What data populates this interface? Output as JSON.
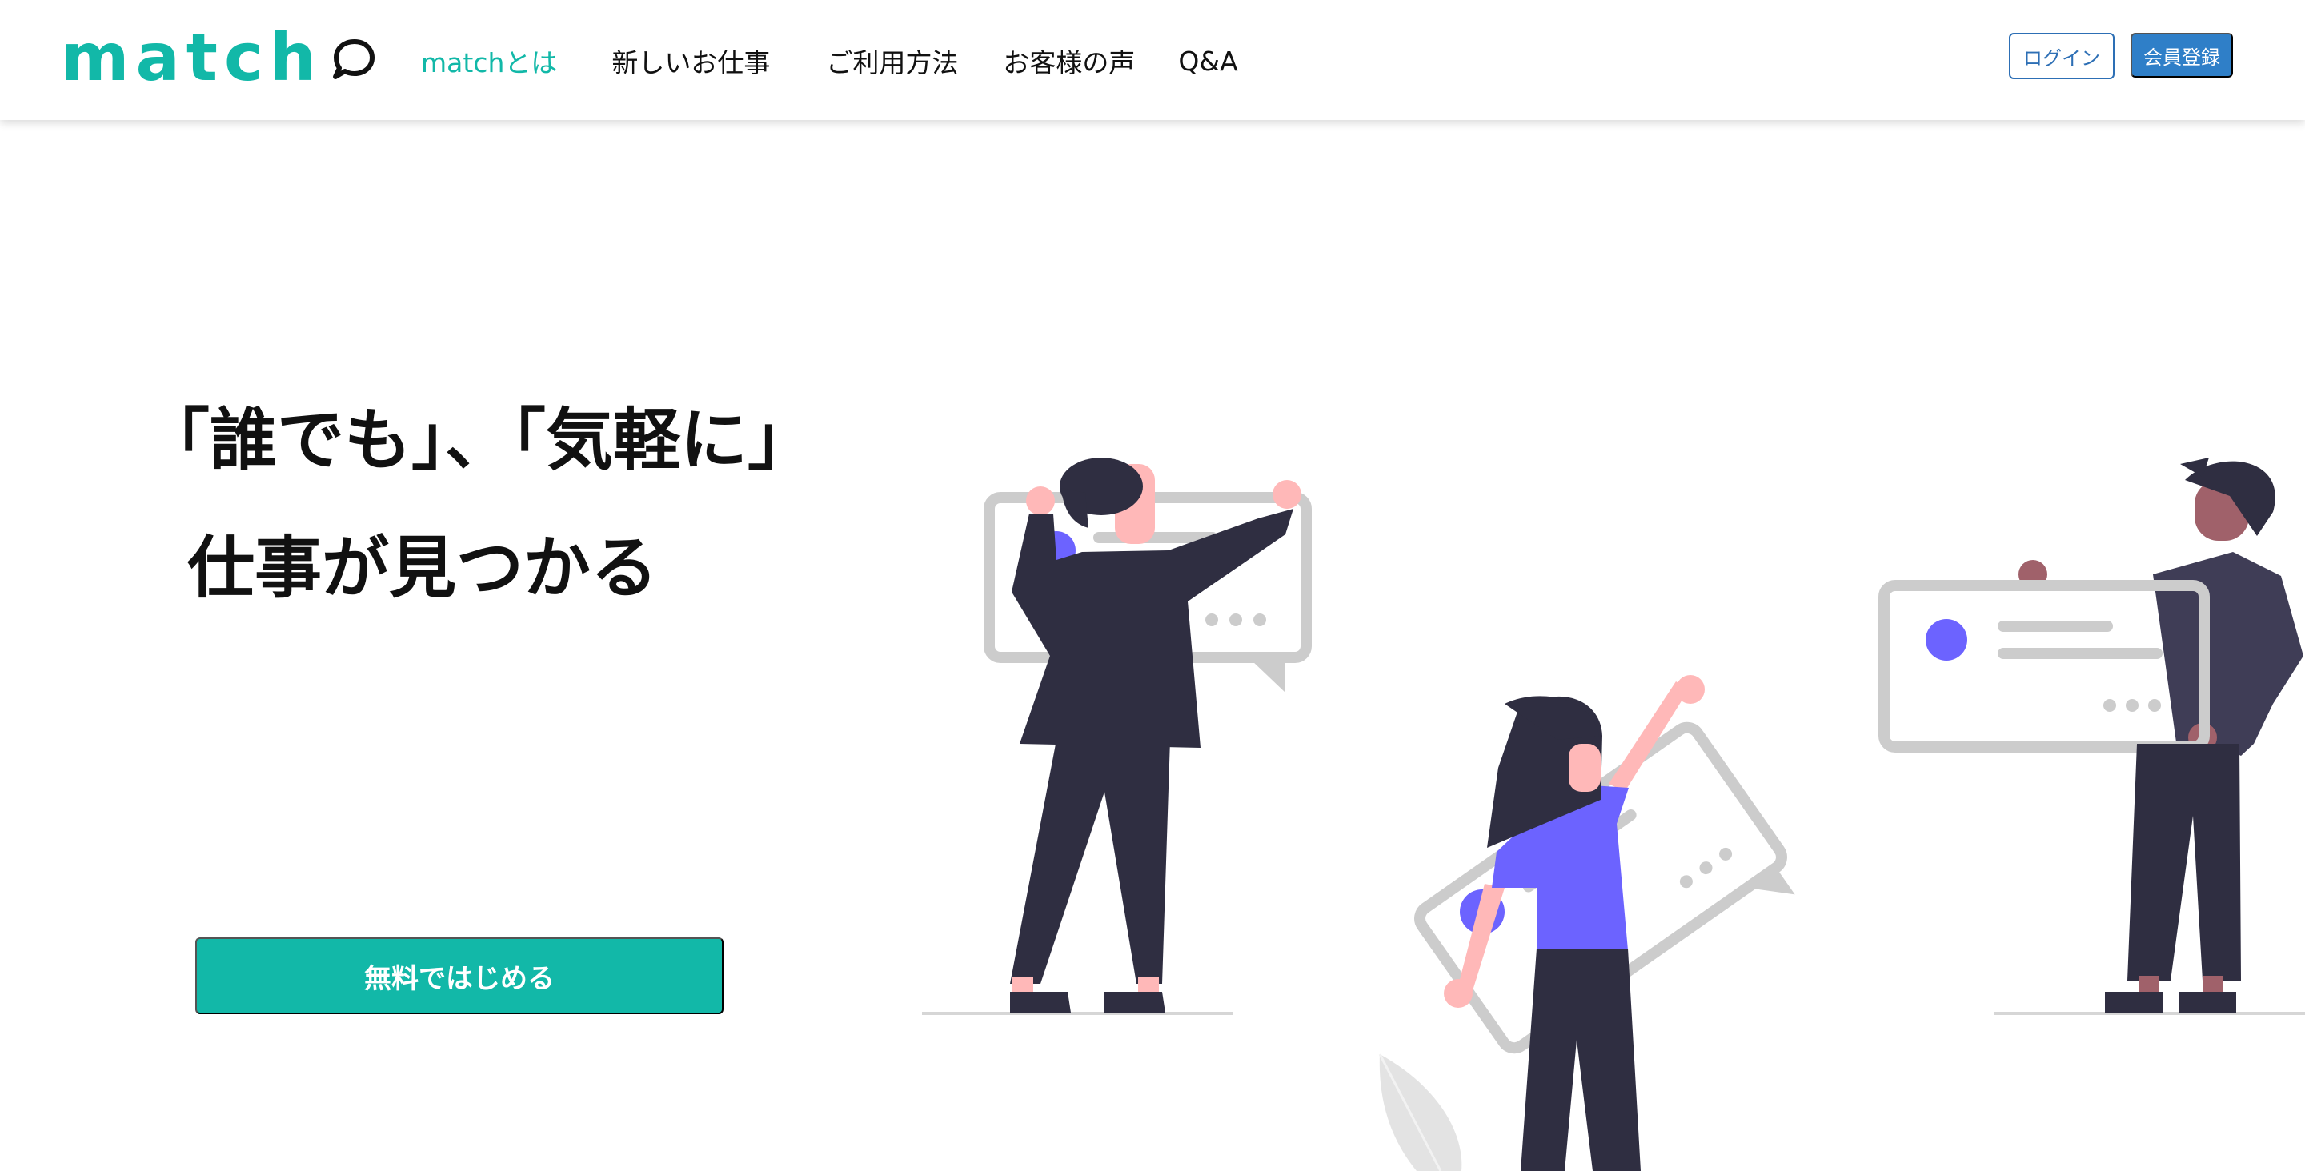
{
  "header": {
    "logo_text": "match",
    "nav": [
      {
        "label": "matchとは",
        "active": true
      },
      {
        "label": "新しいお仕事",
        "active": false
      },
      {
        "label": "ご利用方法",
        "active": false
      },
      {
        "label": "お客様の声",
        "active": false
      },
      {
        "label": "Q&A",
        "active": false
      }
    ],
    "login_label": "ログイン",
    "register_label": "会員登録"
  },
  "hero": {
    "title_line1": "「誰でも」、「気軽に」",
    "title_line2": "仕事が見つかる",
    "cta_label": "無料ではじめる"
  },
  "colors": {
    "brand": "#12b8a8",
    "login_border": "#2d6fb5",
    "register_bg": "#2f7fc8",
    "accent_purple": "#6c63ff",
    "figure_dark": "#2f2e41",
    "skin": "#ffb8b8",
    "bubble_gray": "#cccccc"
  },
  "icons": [
    "speech-bubble-icon"
  ],
  "illustration": "people-holding-chat-bubbles-illustration"
}
